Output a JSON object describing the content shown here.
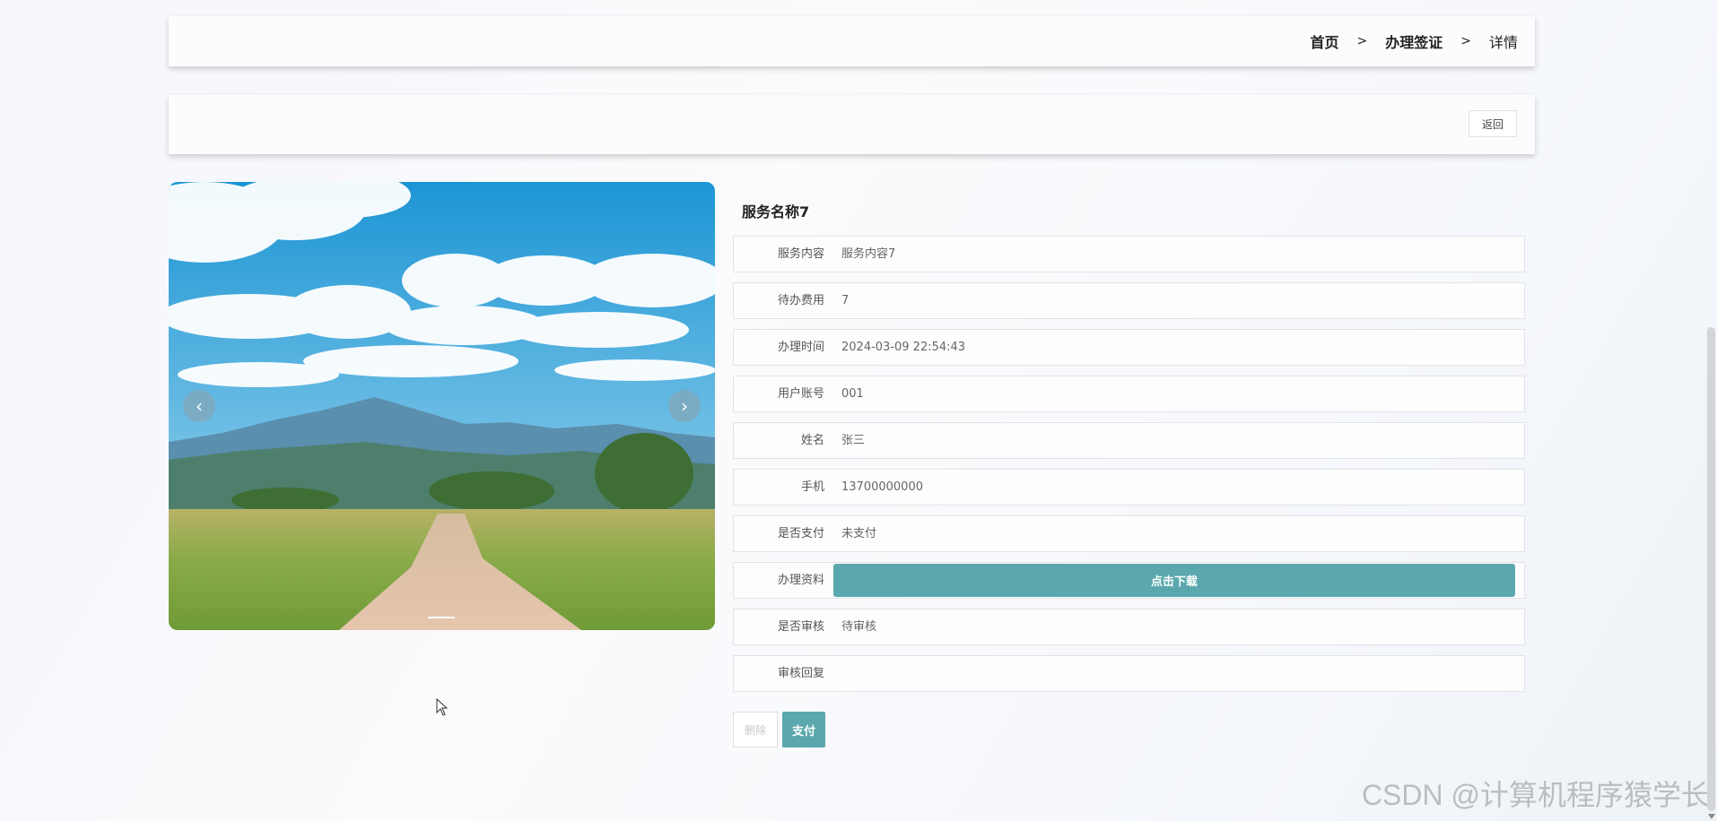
{
  "breadcrumb": {
    "items": [
      "首页",
      "办理签证",
      "详情"
    ],
    "separator": ">"
  },
  "toolbar": {
    "back_label": "返回"
  },
  "carousel": {
    "prev_glyph": "‹",
    "next_glyph": "›"
  },
  "detail": {
    "title": "服务名称7",
    "fields": [
      {
        "label": "服务内容",
        "value": "服务内容7"
      },
      {
        "label": "待办费用",
        "value": "7"
      },
      {
        "label": "办理时间",
        "value": "2024-03-09 22:54:43"
      },
      {
        "label": "用户账号",
        "value": "001"
      },
      {
        "label": "姓名",
        "value": "张三"
      },
      {
        "label": "手机",
        "value": "13700000000"
      },
      {
        "label": "是否支付",
        "value": "未支付"
      },
      {
        "label": "办理资料",
        "value": ""
      },
      {
        "label": "是否审核",
        "value": "待审核"
      },
      {
        "label": "审核回复",
        "value": ""
      }
    ],
    "download_label": "点击下载"
  },
  "actions": {
    "delete_label": "删除",
    "pay_label": "支付"
  },
  "watermark": "CSDN @计算机程序猿学长",
  "colors": {
    "accent": "#5aa8ad",
    "card_bg": "#fcfcfe",
    "border": "#e3e3e6"
  }
}
